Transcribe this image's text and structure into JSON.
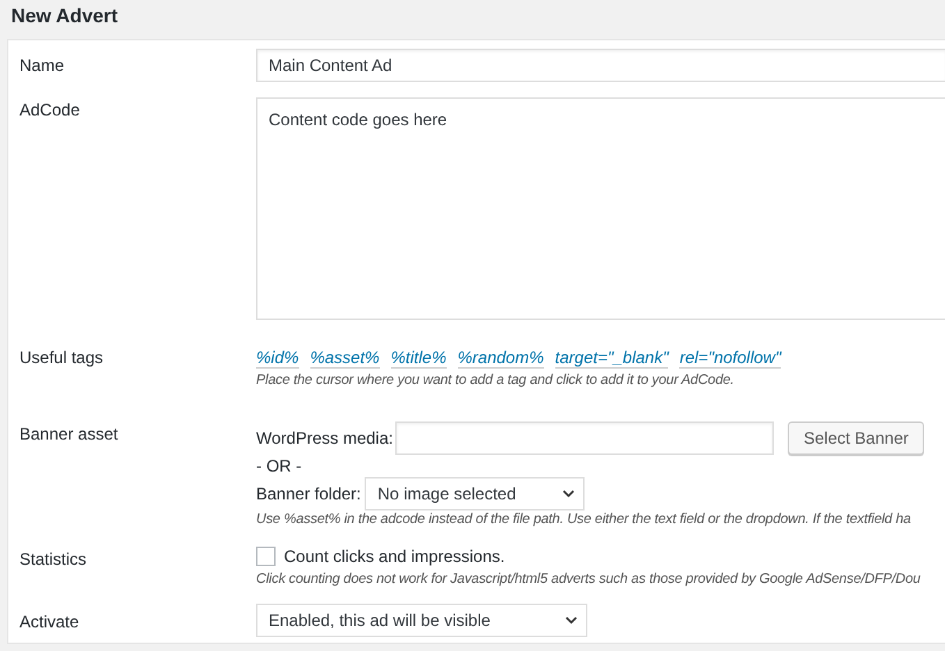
{
  "page_title": "New Advert",
  "fields": [
    {
      "kind": "text",
      "label": "Name",
      "value": "Main Content Ad"
    },
    {
      "kind": "textarea",
      "label": "AdCode",
      "value": "Content code goes here"
    },
    {
      "kind": "tags",
      "label": "Useful tags",
      "tags": [
        "%id%",
        "%asset%",
        "%title%",
        "%random%",
        "target=\"_blank\"",
        "rel=\"nofollow\""
      ],
      "hint": "Place the cursor where you want to add a tag and click to add it to your AdCode."
    },
    {
      "kind": "banner",
      "label": "Banner asset",
      "media_label": "WordPress media:",
      "button": "Select Banner",
      "or": "- OR -",
      "folder_label": "Banner folder:",
      "folder_value": "No image selected",
      "hint": "Use %asset% in the adcode instead of the file path. Use either the text field or the dropdown. If the textfield ha"
    },
    {
      "kind": "checkbox",
      "label": "Statistics",
      "option": "Count clicks and impressions.",
      "checked": false,
      "hint": "Click counting does not work for Javascript/html5 adverts such as those provided by Google AdSense/DFP/Dou"
    },
    {
      "kind": "select",
      "label": "Activate",
      "value": "Enabled, this ad will be visible"
    }
  ]
}
